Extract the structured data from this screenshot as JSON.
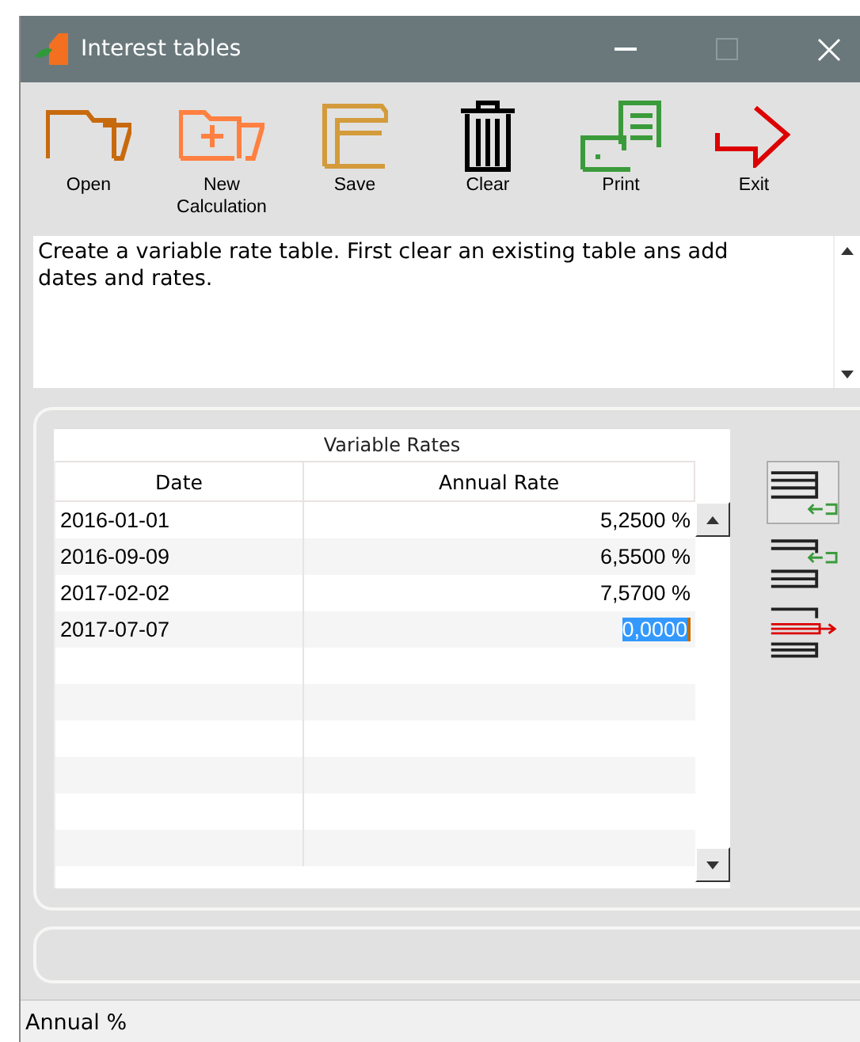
{
  "window": {
    "title": "Interest tables"
  },
  "toolbar": [
    {
      "kind": "open",
      "label": "Open"
    },
    {
      "kind": "new",
      "label": "New\nCalculation"
    },
    {
      "kind": "save",
      "label": "Save"
    },
    {
      "kind": "clear",
      "label": "Clear"
    },
    {
      "kind": "print",
      "label": "Print"
    },
    {
      "kind": "exit",
      "label": "Exit"
    }
  ],
  "description": "Create a variable rate table. First clear an existing table ans add dates and rates.",
  "table": {
    "title": "Variable Rates",
    "columns": [
      "Date",
      "Annual Rate"
    ],
    "rows": [
      {
        "date": "2016-01-01",
        "rate": "5,2500 %",
        "editing": false
      },
      {
        "date": "2016-09-09",
        "rate": "6,5500 %",
        "editing": false
      },
      {
        "date": "2017-02-02",
        "rate": "7,5700 %",
        "editing": false
      },
      {
        "date": "2017-07-07",
        "rate": "0,0000",
        "editing": true
      }
    ]
  },
  "side_buttons": [
    {
      "kind": "append",
      "selected": true
    },
    {
      "kind": "insert",
      "selected": false
    },
    {
      "kind": "delete",
      "selected": false
    }
  ],
  "status_bar": "Annual %"
}
